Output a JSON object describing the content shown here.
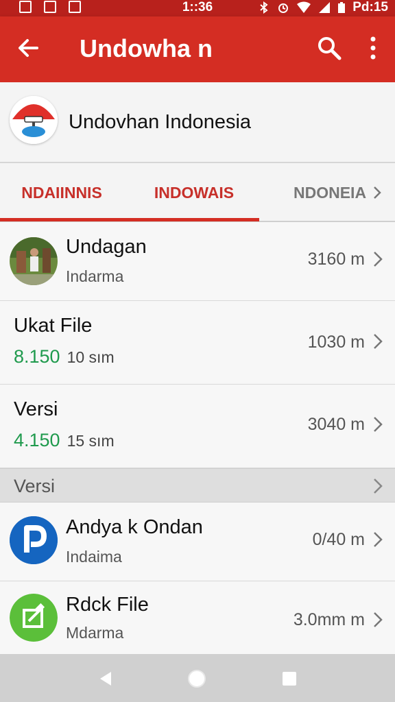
{
  "status_bar": {
    "time": "1::36",
    "right_text": "Pd:15"
  },
  "app_bar": {
    "title": "Undowha n",
    "icons": [
      "back-arrow-icon",
      "search-icon",
      "more-vert-icon"
    ]
  },
  "organization": {
    "name": "Undovhan Indonesia"
  },
  "tabs": [
    {
      "label": "NDAIINNIS"
    },
    {
      "label": "INDOWAIS"
    },
    {
      "label": "NDONEIA"
    }
  ],
  "list": [
    {
      "title": "Undagan",
      "subtitle": "Indarma",
      "distance": "3160 m"
    },
    {
      "title": "Ukat File",
      "number": "8.150",
      "unit": "10 sım",
      "distance": "1030 m"
    },
    {
      "title": "Versi",
      "number": "4.150",
      "unit": "15 sım",
      "distance": "3040 m"
    }
  ],
  "section": {
    "label": "Versi"
  },
  "list2": [
    {
      "title": "Andya k Ondan",
      "subtitle": "Indaima",
      "distance": "0/40 m"
    },
    {
      "title": "Rdck File",
      "subtitle": "Mdarma",
      "distance": "3.0mm m"
    }
  ],
  "colors": {
    "primary": "#d42d23",
    "status_bar": "#b8211c",
    "accent_green": "#1f9a4d",
    "blue_badge": "#1565c0",
    "green_badge": "#5bbf3a"
  }
}
